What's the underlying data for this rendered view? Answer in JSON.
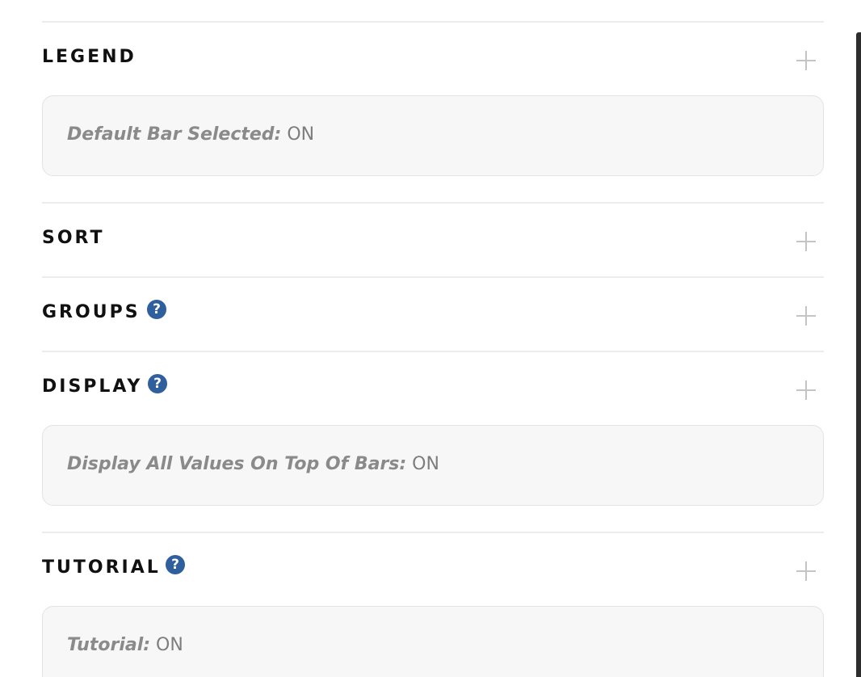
{
  "sections": {
    "legend": {
      "title": "LEGEND",
      "summary": {
        "key": "Default Bar Selected:",
        "value": "ON"
      }
    },
    "sort": {
      "title": "SORT"
    },
    "groups": {
      "title": "GROUPS",
      "help": "?"
    },
    "display": {
      "title": "DISPLAY",
      "help": "?",
      "summary": {
        "key": "Display All Values On Top Of Bars:",
        "value": "ON"
      }
    },
    "tutorial": {
      "title": "TUTORIAL",
      "help": "?",
      "summary": {
        "key": "Tutorial:",
        "value": "ON"
      }
    }
  },
  "icons": {
    "expand": "plus-icon",
    "help": "question-circle-icon"
  },
  "colors": {
    "help_icon": "#2f5f9c",
    "summary_bg": "#f7f7f7",
    "divider": "#ececec"
  }
}
